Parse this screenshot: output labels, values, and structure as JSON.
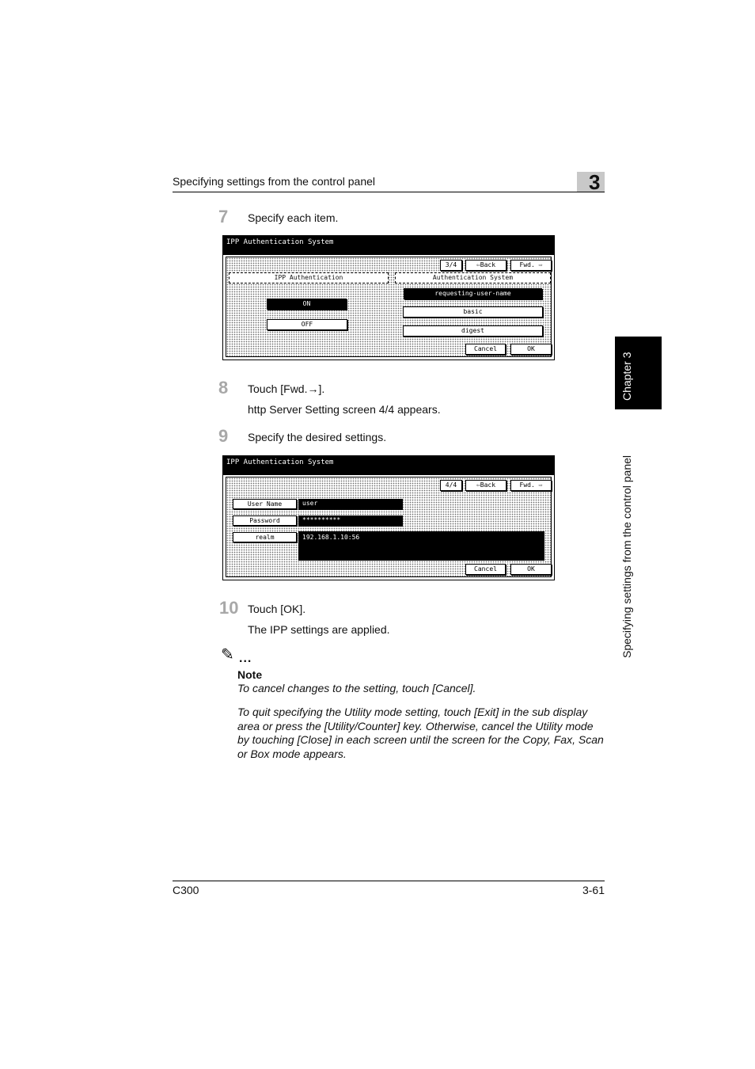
{
  "header": {
    "title": "Specifying settings from the control panel",
    "chapter_number": "3"
  },
  "side_tab": {
    "chapter_label": "Chapter 3",
    "section_label": "Specifying settings from the control panel"
  },
  "steps": [
    {
      "number": "7",
      "text": "Specify each item."
    },
    {
      "number": "8",
      "text": "Touch [Fwd.→].",
      "result": "http Server Setting screen 4/4 appears."
    },
    {
      "number": "9",
      "text": "Specify the desired settings."
    },
    {
      "number": "10",
      "text": "Touch [OK].",
      "result": "The IPP settings are applied."
    }
  ],
  "screen1": {
    "title": "IPP Authentication System",
    "page": "3/4",
    "back": "⇦Back",
    "fwd": "Fwd. ⇨",
    "left_header": "IPP Authentication",
    "right_header": "Authentication System",
    "on": "ON",
    "off": "OFF",
    "opt1": "requesting-user-name",
    "opt2": "basic",
    "opt3": "digest",
    "cancel": "Cancel",
    "ok": "OK"
  },
  "screen2": {
    "title": "IPP Authentication System",
    "page": "4/4",
    "back": "⇦Back",
    "fwd": "Fwd. ⇨",
    "user_label": "User Name",
    "user_value": "user",
    "pass_label": "Password",
    "pass_value": "**********",
    "realm_label": "realm",
    "realm_value": "192.168.1.10:56",
    "cancel": "Cancel",
    "ok": "OK"
  },
  "note": {
    "icon": "✎",
    "dots": "...",
    "title": "Note",
    "p1": "To cancel changes to the setting, touch [Cancel].",
    "p2": "To quit specifying the Utility mode setting, touch [Exit] in the sub display area or press the [Utility/Counter] key. Otherwise, cancel the Utility mode by touching [Close] in each screen until the screen for the Copy, Fax, Scan or Box mode appears."
  },
  "footer": {
    "model": "C300",
    "page": "3-61"
  }
}
